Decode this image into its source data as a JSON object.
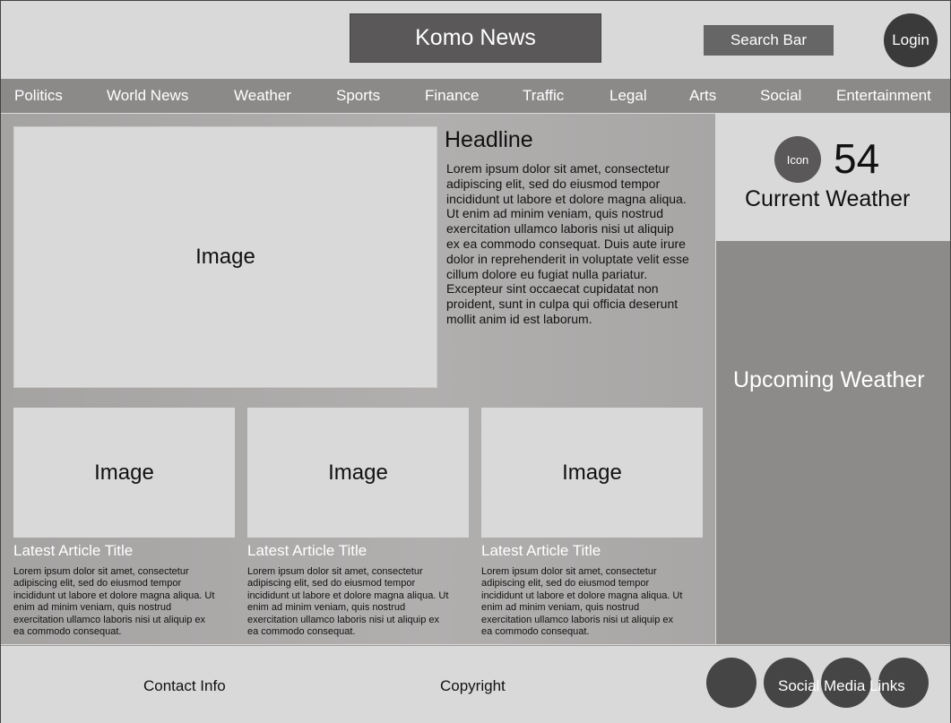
{
  "header": {
    "logo": "Komo News",
    "search": "Search Bar",
    "login": "Login"
  },
  "nav": [
    "Politics",
    "World News",
    "Weather",
    "Sports",
    "Finance",
    "Traffic",
    "Legal",
    "Arts",
    "Social",
    "Entertainment"
  ],
  "hero": {
    "image_label": "Image",
    "headline": "Headline",
    "body": "Lorem ipsum dolor sit amet, consectetur adipiscing elit, sed do eiusmod tempor incididunt ut labore et dolore magna aliqua. Ut enim ad minim veniam, quis nostrud exercitation ullamco laboris nisi ut aliquip ex ea commodo consequat. Duis aute irure dolor in reprehenderit in voluptate velit esse cillum dolore eu fugiat nulla pariatur. Excepteur sint occaecat cupidatat non proident, sunt in culpa qui officia deserunt mollit anim id est laborum."
  },
  "articles": [
    {
      "image_label": "Image",
      "title": "Latest Article Title",
      "body": "Lorem ipsum dolor sit amet, consectetur adipiscing elit, sed do eiusmod tempor incididunt ut labore et dolore magna aliqua. Ut enim ad minim veniam, quis nostrud exercitation ullamco laboris nisi ut aliquip ex ea commodo consequat."
    },
    {
      "image_label": "Image",
      "title": "Latest Article Title",
      "body": "Lorem ipsum dolor sit amet, consectetur adipiscing elit, sed do eiusmod tempor incididunt ut labore et dolore magna aliqua. Ut enim ad minim veniam, quis nostrud exercitation ullamco laboris nisi ut aliquip ex ea commodo consequat."
    },
    {
      "image_label": "Image",
      "title": "Latest Article Title",
      "body": "Lorem ipsum dolor sit amet, consectetur adipiscing elit, sed do eiusmod tempor incididunt ut labore et dolore magna aliqua. Ut enim ad minim veniam, quis nostrud exercitation ullamco laboris nisi ut aliquip ex ea commodo consequat."
    }
  ],
  "weather": {
    "icon_label": "Icon",
    "temperature": "54",
    "current_label": "Current Weather",
    "upcoming_label": "Upcoming Weather"
  },
  "footer": {
    "contact": "Contact Info",
    "copyright": "Copyright",
    "social_label": "Social Media Links"
  },
  "colors": {
    "dark": "#5a5858",
    "nav": "#8c8989",
    "panel_light": "#d9d9d9",
    "upcoming": "#8c8b8a",
    "social_circle": "#464545"
  }
}
